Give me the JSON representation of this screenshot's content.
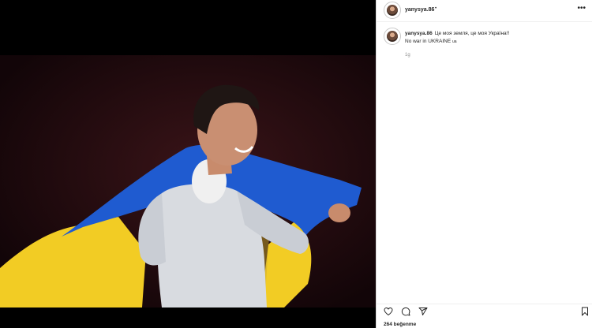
{
  "post": {
    "username": "yanysya.86",
    "separator": "•",
    "caption_line1": "Це моя земля, це моя Україна!!",
    "caption_line2": "No war in UKRAINE",
    "caption_flag": "ua",
    "age": "1g",
    "likes": "264 beğenme"
  },
  "icons": {
    "more": "more-options-icon",
    "like": "heart-icon",
    "comment": "comment-icon",
    "share": "send-icon",
    "save": "bookmark-icon"
  },
  "colors": {
    "flag_blue": "#1f5bd0",
    "flag_yellow": "#f2cc24",
    "text": "#262626",
    "muted": "#8e8e8e"
  }
}
